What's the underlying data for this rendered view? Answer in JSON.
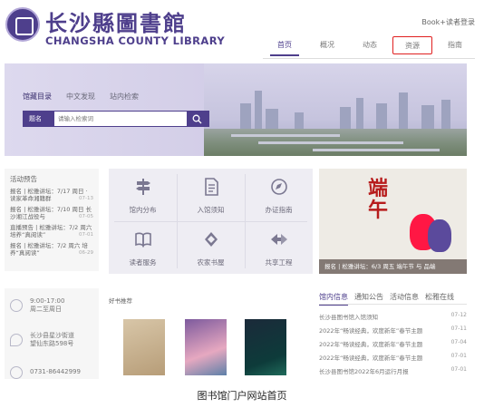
{
  "header": {
    "logo_cn": "长沙縣圖書館",
    "logo_en": "CHANGSHA COUNTY LIBRARY",
    "login": "Book+读者登录",
    "nav": [
      {
        "label": "首页",
        "state": "active"
      },
      {
        "label": "概况",
        "state": ""
      },
      {
        "label": "动态",
        "state": ""
      },
      {
        "label": "资源",
        "state": "highlighted"
      },
      {
        "label": "指南",
        "state": ""
      }
    ]
  },
  "banner": {
    "tabs": [
      "馆藏目录",
      "中文发现",
      "站内检索"
    ],
    "search_select": "题名",
    "search_placeholder": "请输入检索词"
  },
  "activity": {
    "title": "活动预告",
    "items": [
      {
        "text": "报名 | 松雅讲坛：7/17 周日 · 读家革命湘籍群",
        "date": "07-13"
      },
      {
        "text": "报名 | 松雅讲坛：7/10 周日 长沙湘江战役与",
        "date": "07-05"
      },
      {
        "text": "直播预告 | 松雅讲坛：7/2 周六 培养“真阅读”",
        "date": "07-01"
      },
      {
        "text": "报名 | 松雅讲坛：7/2 周六 培养“真阅读”",
        "date": "06-29"
      }
    ]
  },
  "services": [
    {
      "label": "馆内分布",
      "icon": "signpost-icon"
    },
    {
      "label": "入馆须知",
      "icon": "document-icon"
    },
    {
      "label": "办证指南",
      "icon": "compass-icon"
    },
    {
      "label": "读者服务",
      "icon": "book-icon"
    },
    {
      "label": "农家书屋",
      "icon": "diamond-icon"
    },
    {
      "label": "共享工程",
      "icon": "arrows-icon"
    }
  ],
  "poster": {
    "title_vertical": "端午",
    "caption": "报名 | 松雅讲坛：6/3 周五 端午节 与 品端"
  },
  "info": {
    "hours": "9:00-17:00\n周二至周日",
    "address": "长沙县星沙街道\n望仙东路598号",
    "phone": "0731-86442999"
  },
  "books": {
    "title": "好书推荐"
  },
  "news": {
    "tabs": [
      "馆内信息",
      "通知公告",
      "活动信息",
      "松雅在线"
    ],
    "items": [
      {
        "text": "长沙县图书馆入馆须知",
        "date": "07-12"
      },
      {
        "text": "2022年“畅读经典，欢度新年”春节主题",
        "date": "07-11"
      },
      {
        "text": "2022年“畅读经典，欢度新年”春节主题",
        "date": "07-04"
      },
      {
        "text": "2022年“畅读经典，欢度新年”春节主题",
        "date": "07-01"
      },
      {
        "text": "长沙县图书馆2022年6月运行月报",
        "date": "07-01"
      }
    ]
  },
  "caption": "图书馆门户网站首页",
  "colors": {
    "brand": "#4e3f8c",
    "highlight": "#e02020"
  }
}
